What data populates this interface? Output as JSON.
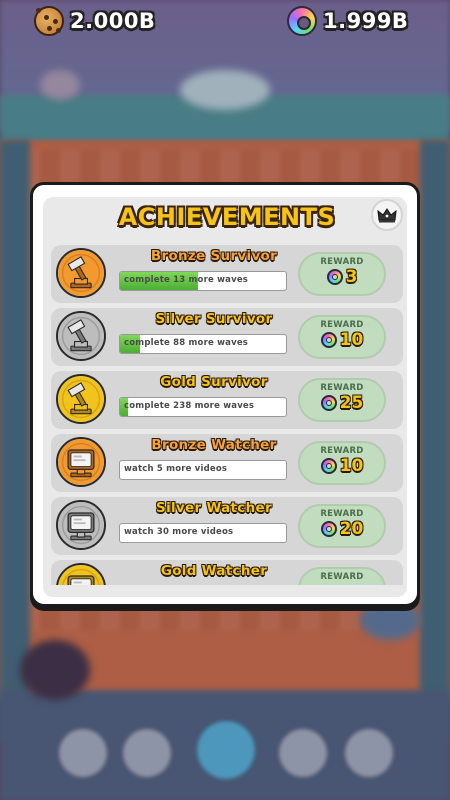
{
  "currencies": {
    "cookies": {
      "icon": "cookie-icon",
      "value": "2.000B"
    },
    "donuts": {
      "icon": "donut-icon",
      "value": "1.999B"
    }
  },
  "panel": {
    "title": "ACHIEVEMENTS",
    "crown_icon": "crown-icon"
  },
  "achievements": [
    {
      "name": "Bronze Survivor",
      "tier": "bronze",
      "icon": "hammer-trophy-icon",
      "progress_text": "complete 13 more waves",
      "progress": 0.47,
      "reward_label": "REWARD",
      "reward": "3"
    },
    {
      "name": "Silver Survivor",
      "tier": "silver",
      "icon": "hammer-trophy-icon",
      "progress_text": "complete 88 more waves",
      "progress": 0.12,
      "reward_label": "REWARD",
      "reward": "10"
    },
    {
      "name": "Gold Survivor",
      "tier": "gold",
      "icon": "hammer-trophy-icon",
      "progress_text": "complete 238 more waves",
      "progress": 0.05,
      "reward_label": "REWARD",
      "reward": "25"
    },
    {
      "name": "Bronze Watcher",
      "tier": "bronze",
      "icon": "tv-trophy-icon",
      "progress_text": "watch 5 more videos",
      "progress": 0,
      "reward_label": "REWARD",
      "reward": "10"
    },
    {
      "name": "Silver Watcher",
      "tier": "silver",
      "icon": "tv-trophy-icon",
      "progress_text": "watch 30 more videos",
      "progress": 0,
      "reward_label": "REWARD",
      "reward": "20"
    },
    {
      "name": "Gold Watcher",
      "tier": "gold",
      "icon": "tv-trophy-icon",
      "progress_text": "",
      "progress": 0,
      "reward_label": "REWARD",
      "reward": ""
    }
  ],
  "colors": {
    "bronze_name": "#f7a23a",
    "silver_name": "#f6c419",
    "gold_name": "#f6c419",
    "bronze_medal": "#f29a2e",
    "silver_medal": "#bdbdbd",
    "gold_medal": "#f2c21d"
  }
}
